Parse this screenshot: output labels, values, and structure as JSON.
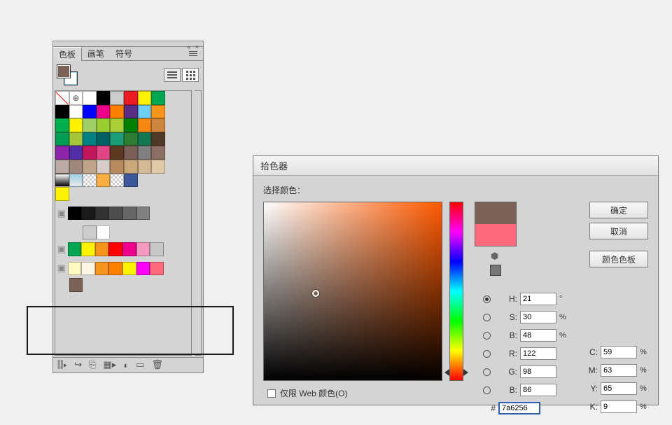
{
  "swatches_panel": {
    "tabs": [
      "色板",
      "画笔",
      "符号"
    ],
    "active_tab": 0,
    "fg_color": "#7a6256",
    "bg_color": "#ffffff",
    "main_grid": [
      "none",
      "reg",
      "#ffffff",
      "#000000",
      "#cccccc",
      "#ed1c24",
      "#fff200",
      "#00a651",
      "",
      "",
      "#000000",
      "#ffffff",
      "#0000ff",
      "#ec008c",
      "#ff7f00",
      "#582d83",
      "#6dcff6",
      "#f7941d",
      "",
      "",
      "#00b050",
      "#fff200",
      "#a0ce67",
      "#9acd32",
      "#aace38",
      "#008000",
      "#f68712",
      "#cd853f",
      "",
      "",
      "#009e54",
      "#a4c639",
      "#008080",
      "#006064",
      "#1b9e77",
      "#2e7d32",
      "#137752",
      "#4f3a28",
      "",
      "",
      "#8e24aa",
      "#512da8",
      "#c2185b",
      "#e24585",
      "#5c3a21",
      "#7b5e57",
      "#808080",
      "#8d6e63",
      "",
      "",
      "#bcaaa4",
      "#a1887f",
      "#bfa58a",
      "#d7ccc8",
      "#b88b5e",
      "#c9a97a",
      "#d5b895",
      "#e0c9a6",
      "",
      "",
      "grad-bw",
      "grad-sky",
      "checker",
      "#fbae42",
      "checker",
      "#3b5998",
      "",
      "",
      "",
      "",
      "#fff200",
      "",
      "",
      "",
      "",
      "",
      "",
      "",
      "",
      ""
    ],
    "group1": [
      "#000000",
      "#1a1a1a",
      "#333333",
      "#4d4d4d",
      "#666666",
      "#808080"
    ],
    "group2_top": [
      "",
      "#cccccc",
      "#ffffff"
    ],
    "group2": [
      "#00a651",
      "#fff200",
      "#f7941d",
      "#ff0000",
      "#ec008c",
      "#f49ac1",
      "#c7c7c7"
    ],
    "group3": [
      "#fff9c4",
      "#fdf5e6",
      "#f7941d",
      "#ff8000",
      "#fff200",
      "#ff00ff",
      "#ff6b7d"
    ],
    "group3_row2": [
      "#7a6256"
    ],
    "footer_icons": [
      "library",
      "swap",
      "link",
      "new-template",
      "color-group",
      "new-swatch",
      "delete"
    ]
  },
  "picker": {
    "title": "拾色器",
    "label": "选择颜色：",
    "buttons": {
      "ok": "确定",
      "cancel": "取消",
      "swatches": "颜色色板"
    },
    "hsb": {
      "h": "21",
      "s": "30",
      "b": "48"
    },
    "rgb": {
      "r": "122",
      "g": "98",
      "b": "86"
    },
    "cmyk": {
      "c": "59",
      "m": "63",
      "y": "65",
      "k": "9"
    },
    "hex": "7a6256",
    "hsb_units": {
      "h": "°",
      "s": "%",
      "b": "%"
    },
    "cmyk_unit": "%",
    "labels": {
      "h": "H:",
      "s": "S:",
      "bb": "B:",
      "r": "R:",
      "g": "G:",
      "b": "B:",
      "c": "C:",
      "m": "M:",
      "y": "Y:",
      "k": "K:",
      "hash": "#"
    },
    "webonly": "仅限 Web 颜色(O)",
    "current_color": "#7a6256",
    "previous_color": "#ff6b7d",
    "selected_channel": "h"
  }
}
